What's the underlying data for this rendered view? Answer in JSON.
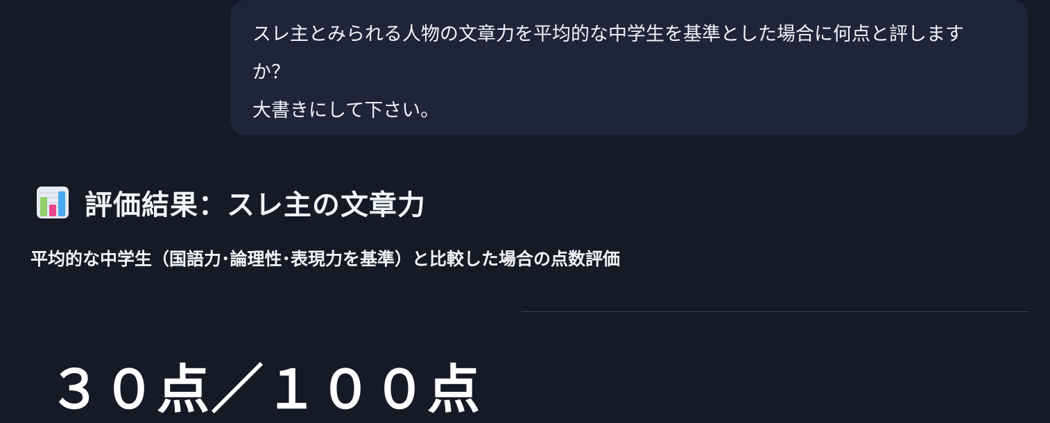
{
  "user_message": {
    "lines": [
      "スレ主とみられる人物の文章力を平均的な中学生を基準とした場合に何点と評しますか？",
      "大書きにして下さい。"
    ],
    "wrap_first_line": "スレ主とみられる人物の文章力を平均的な中学生を基準とした場合に何点と評します",
    "wrap_second_line": "か？"
  },
  "response": {
    "icon": "bar-chart-emoji-icon",
    "heading": "評価結果：スレ主の文章力",
    "subtitle": "平均的な中学生（国語力･論理性･表現力を基準）と比較した場合の点数評価",
    "score": "３０点／１００点"
  },
  "colors": {
    "background": "#161a27",
    "user_bubble": "#202439",
    "text": "#f2f3f8",
    "divider": "#3c4152"
  }
}
